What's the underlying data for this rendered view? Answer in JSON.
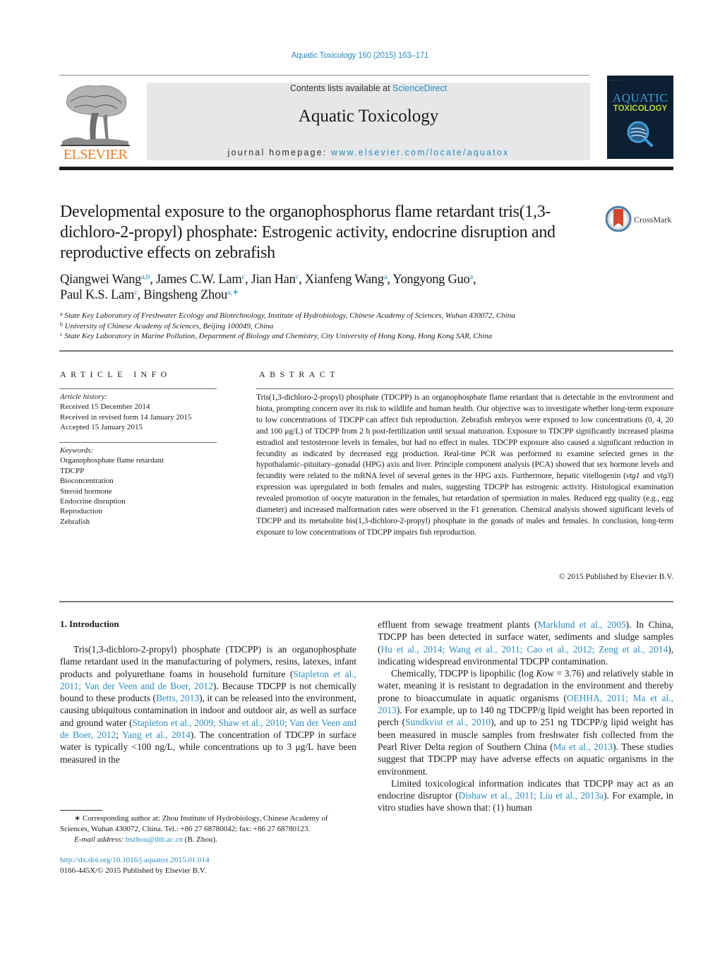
{
  "header": {
    "citation": "Aquatic Toxicology 160 (2015) 163–171",
    "contents_prefix": "Contents lists available at ",
    "contents_link": "ScienceDirect",
    "journal_title": "Aquatic Toxicology",
    "homepage_prefix": "journal homepage: ",
    "homepage_link": "www.elsevier.com/locate/aquatox",
    "publisher_logo_text": "ELSEVIER",
    "cover": {
      "line1": "AQUATIC",
      "line2": "TOXICOLOGY"
    },
    "colors": {
      "link": "#2a8ec2",
      "elsevier_orange": "#f07d21",
      "masthead_bg": "#e6e7e8",
      "cover_bg": "#0d1f33",
      "cover_green": "#b9d437"
    }
  },
  "article": {
    "title": "Developmental exposure to the organophosphorus flame retardant tris(1,3-dichloro-2-propyl) phosphate: Estrogenic activity, endocrine disruption and reproductive effects on zebrafish",
    "crossmark_label": "CrossMark",
    "authors": [
      {
        "name": "Qiangwei Wang",
        "aff": "a,b"
      },
      {
        "name": "James C.W. Lam",
        "aff": "c"
      },
      {
        "name": "Jian Han",
        "aff": "c"
      },
      {
        "name": "Xianfeng Wang",
        "aff": "a"
      },
      {
        "name": "Yongyong Guo",
        "aff": "a"
      },
      {
        "name": "Paul K.S. Lam",
        "aff": "c"
      },
      {
        "name": "Bingsheng Zhou",
        "aff": "a,∗"
      }
    ],
    "affiliations": [
      {
        "key": "a",
        "text": "State Key Laboratory of Freshwater Ecology and Biotechnology, Institute of Hydrobiology, Chinese Academy of Sciences, Wuhan 430072, China"
      },
      {
        "key": "b",
        "text": "University of Chinese Academy of Sciences, Beijing 100049, China"
      },
      {
        "key": "c",
        "text": "State Key Laboratory in Marine Pollution, Department of Biology and Chemistry, City University of Hong Kong, Hong Kong SAR, China"
      }
    ]
  },
  "article_info": {
    "heading": "ARTICLE INFO",
    "history_label": "Article history:",
    "history": [
      "Received 15 December 2014",
      "Received in revised form 14 January 2015",
      "Accepted 15 January 2015"
    ],
    "keywords_label": "Keywords:",
    "keywords": [
      "Organophosphate flame retardant",
      "TDCPP",
      "Bioconcentration",
      "Steroid hormone",
      "Endocrine disruption",
      "Reproduction",
      "Zebrafish"
    ]
  },
  "abstract": {
    "heading": "ABSTRACT",
    "part1": "Tris(1,3-dichloro-2-propyl) phosphate (TDCPP) is an organophosphate flame retardant that is detectable in the environment and biota, prompting concern over its risk to wildlife and human health. Our objective was to investigate whether long-term exposure to low concentrations of TDCPP can affect fish reproduction. Zebrafish embryos were exposed to low concentrations (0, 4, 20 and 100 μg/L) of TDCPP from 2 h post-fertilization until sexual maturation. Exposure to TDCPP significantly increased plasma estradiol and testosterone levels in females, but had no effect in males. TDCPP exposure also caused a significant reduction in fecundity as indicated by decreased egg production. Real-time PCR was performed to examine selected genes in the hypothalamic–pituitary–gonadal (HPG) axis and liver. Principle component analysis (PCA) showed that sex hormone levels and fecundity were related to the mRNA level of several genes in the HPG axis. Furthermore, hepatic vitellogenin (",
    "gene1": "vtg1",
    "and": " and ",
    "gene2": "vtg3",
    "part2": ") expression was upregulated in both females and males, suggesting TDCPP has estrogenic activity. Histological examination revealed promotion of oocyte maturation in the females, but retardation of spermiation in males. Reduced egg quality (e.g., egg diameter) and increased malformation rates were observed in the F1 generation. Chemical analysis showed significant levels of TDCPP and its metabolite bis(1,3-dichloro-2-propyl) phosphate in the gonads of males and females. In conclusion, long-term exposure to low concentrations of TDCPP impairs fish reproduction.",
    "copyright": "© 2015 Published by Elsevier B.V."
  },
  "introduction": {
    "heading": "1.  Introduction",
    "left": {
      "t1": "Tris(1,3-dichloro-2-propyl) phosphate (TDCPP) is an organophosphate flame retardant used in the manufacturing of polymers, resins, latexes, infant products and polyurethane foams in household furniture (",
      "r1": "Stapleton et al., 2011; Van der Veen and de Boer, 2012",
      "t2": "). Because TDCPP is not chemically bound to these products (",
      "r2": "Betts, 2013",
      "t3": "), it can be released into the environment, causing ubiquitous contamination in indoor and outdoor air, as well as surface and ground water (",
      "r3": "Stapleton et al., 2009; Shaw et al., 2010; Van der Veen and de Boer, 2012",
      "t4": "; ",
      "r4": "Yang et al., 2014",
      "t5": "). The concentration of TDCPP in surface water is typically <100 ng/L, while concentrations up to 3 μg/L have been measured in the"
    },
    "right": {
      "p1_t1": "effluent from sewage treatment plants (",
      "p1_r1": "Marklund et al., 2005",
      "p1_t2": "). In China, TDCPP has been detected in surface water, sediments and sludge samples (",
      "p1_r2": "Hu et al., 2014; Wang et al., 2011; Cao et al., 2012; Zeng et al., 2014",
      "p1_t3": "), indicating widespread environmental TDCPP contamination.",
      "p2_t1": "Chemically, TDCPP is lipophilic (log ",
      "p2_k": "K",
      "p2_t2": "ow = 3.76) and relatively stable in water, meaning it is resistant to degradation in the environment and thereby prone to bioaccumulate in aquatic organisms (",
      "p2_r1": "OEHHA, 2011; Ma et al., 2013",
      "p2_t3": "). For example, up to 140 ng TDCPP/g lipid weight has been reported in perch (",
      "p2_r2": "Sundkvist et al., 2010",
      "p2_t4": "), and up to 251 ng TDCPP/g lipid weight has been measured in muscle samples from freshwater fish collected from the Pearl River Delta region of Southern China (",
      "p2_r3": "Ma et al., 2013",
      "p2_t5": "). These studies suggest that TDCPP may have adverse effects on aquatic organisms in the environment.",
      "p3_t1": "Limited toxicological information indicates that TDCPP may act as an endocrine disruptor (",
      "p3_r1": "Dishaw et al., 2011; Liu et al., 2013a",
      "p3_t2": "). For example, in vitro studies have shown that: (1) human"
    }
  },
  "footnote": {
    "corresponding": "∗  Corresponding author at: Zhou Institute of Hydrobiology, Chinese Academy of Sciences, Wuhan 430072, China. Tel.: +86 27 68780042; fax: +86 27 68780123.",
    "email_label": "E-mail address:",
    "email": "bszhou@ihb.ac.cn",
    "email_suffix": " (B. Zhou).",
    "doi": "http://dx.doi.org/10.1016/j.aquatox.2015.01.014",
    "issn": "0166-445X/© 2015 Published by Elsevier B.V."
  }
}
